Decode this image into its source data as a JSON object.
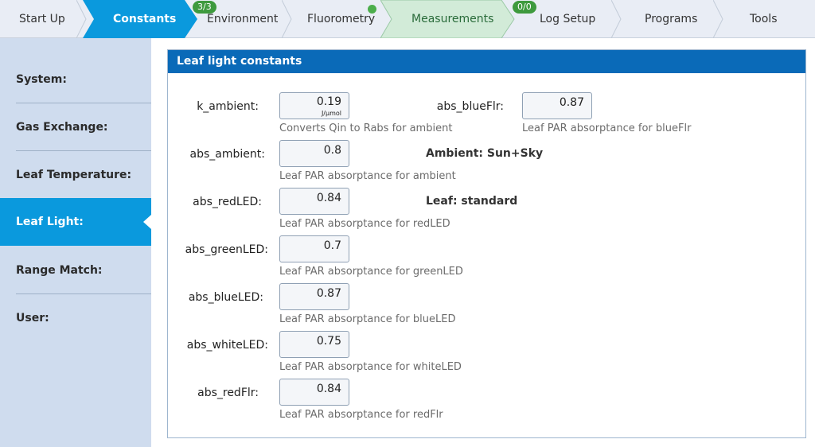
{
  "tabs": [
    {
      "label": "Start Up",
      "badge": null,
      "active": false
    },
    {
      "label": "Constants",
      "badge": null,
      "active": true
    },
    {
      "label": "Environment",
      "badge": "3/3",
      "active": false
    },
    {
      "label": "Fluorometry",
      "badge": null,
      "status_dot": true,
      "active": false
    },
    {
      "label": "Measurements",
      "badge": null,
      "active": false,
      "highlighted": true
    },
    {
      "label": "Log Setup",
      "badge": "0/0",
      "active": false
    },
    {
      "label": "Programs",
      "badge": null,
      "active": false
    },
    {
      "label": "Tools",
      "badge": null,
      "active": false
    }
  ],
  "sidebar": {
    "items": [
      {
        "label": "System:",
        "active": false
      },
      {
        "label": "Gas Exchange:",
        "active": false
      },
      {
        "label": "Leaf Temperature:",
        "active": false
      },
      {
        "label": "Leaf Light:",
        "active": true
      },
      {
        "label": "Range Match:",
        "active": false
      },
      {
        "label": "User:",
        "active": false
      }
    ]
  },
  "panel": {
    "title": "Leaf light constants",
    "fields": [
      {
        "label": "k_ambient:",
        "value": "0.19",
        "unit": "J/µmol",
        "help": "Converts Qin to Rabs for ambient"
      },
      {
        "label": "abs_ambient:",
        "value": "0.8",
        "unit": "",
        "help": "Leaf PAR absorptance for ambient"
      },
      {
        "label": "abs_redLED:",
        "value": "0.84",
        "unit": "",
        "help": "Leaf PAR absorptance for redLED"
      },
      {
        "label": "abs_greenLED:",
        "value": "0.7",
        "unit": "",
        "help": "Leaf PAR absorptance for greenLED"
      },
      {
        "label": "abs_blueLED:",
        "value": "0.87",
        "unit": "",
        "help": "Leaf PAR absorptance for blueLED"
      },
      {
        "label": "abs_whiteLED:",
        "value": "0.75",
        "unit": "",
        "help": "Leaf PAR absorptance for whiteLED"
      },
      {
        "label": "abs_redFlr:",
        "value": "0.84",
        "unit": "",
        "help": "Leaf PAR absorptance for redFlr"
      }
    ],
    "right_field": {
      "label": "abs_blueFlr:",
      "value": "0.87",
      "help": "Leaf PAR absorptance for blueFlr"
    },
    "ambient_selector": "Ambient: Sun+Sky",
    "leaf_selector": "Leaf: standard"
  },
  "colors": {
    "active_tab": "#0a99dd",
    "measurements_tab": "#d2ebd8",
    "badge": "#3e9a3e",
    "panel_header": "#0a6ab8",
    "sidebar_bg": "#cfdcee"
  }
}
